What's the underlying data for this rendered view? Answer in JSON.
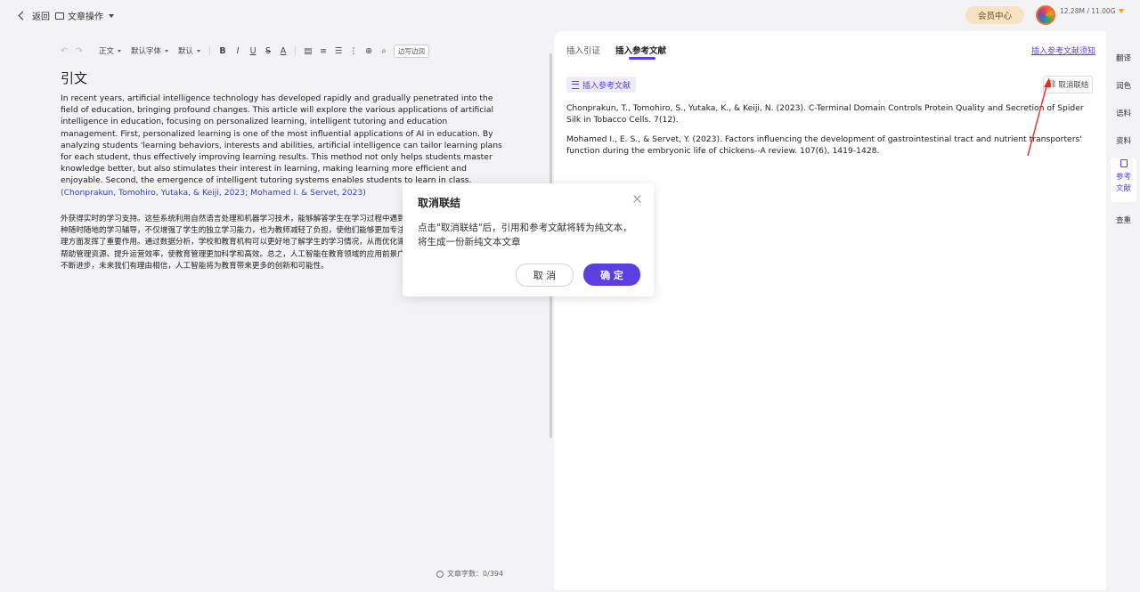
{
  "topbar": {
    "back_label": "返回",
    "doc_menu_label": "文章操作",
    "vip_label": "会员中心",
    "storage": "12.28M / 11.00G"
  },
  "toolbar": {
    "paragraph_style": "正文",
    "font_family": "默认字体",
    "font_size": "默认",
    "edit_mode_label": "边写边润"
  },
  "editor": {
    "title": "引文",
    "english_paragraph": "In recent years, artificial intelligence technology has developed rapidly and gradually penetrated into the field of education, bringing profound changes. This article will explore the various applications of artificial intelligence in education, focusing on personalized learning, intelligent tutoring and education management. First, personalized learning is one of the most influential applications of AI in education. By analyzing students 'learning behaviors, interests and abilities, artificial intelligence can tailor learning plans for each student, thus effectively improving learning results. This method not only helps students master knowledge better, but also stimulates their interest in learning, making learning more efficient and enjoyable. Second, the emergence of intelligent tutoring systems enables students to learn in class.",
    "english_citation": "(Chonprakun, Tomohiro, Yutaka, & Keiji, 2023; Mohamed I. & Servet, 2023)",
    "chinese_paragraph": "外获得实时的学习支持。这些系统利用自然语言处理和机器学习技术，能够解答学生在学习过程中遇到的问题，并提供个性化的反馈和建议。这种随时随地的学习辅导，不仅增强了学生的独立学习能力，也为教师减轻了负担，使他们能够更加专注于教学本身。此外，人工智能还在教育管理方面发挥了重要作用。通过数据分析，学校和教育机构可以更好地了解学生的学习情况，从而优化课程设置和教学策略。同时，人工智能可以帮助管理资源、提升运营效率，使教育管理更加科学和高效。总之，人工智能在教育领域的应用前景广阔，正在重新定义教学模式。随着技术的不断进步，未来我们有理由相信，人工智能将为教育带来更多的创新和可能性。",
    "word_count": "文章字数：0/394"
  },
  "panel": {
    "tabs": [
      {
        "label": "插入引证"
      },
      {
        "label": "插入参考文献"
      }
    ],
    "notice_link": "插入参考文献须知",
    "insert_button": "插入参考文献",
    "unlink_button": "取消联结",
    "references": [
      "Chonprakun, T., Tomohiro, S., Yutaka, K., & Keiji, N. (2023). C-Terminal Domain Controls Protein Quality and Secretion of Spider Silk in Tobacco Cells. 7(12).",
      "Mohamed I., E. S., & Servet, Y. (2023). Factors influencing the development of gastrointestinal tract and nutrient transporters' function during the embryonic life of chickens--A review. 107(6), 1419-1428."
    ]
  },
  "sidebar": {
    "items": [
      {
        "label": "翻译"
      },
      {
        "label": "润色"
      },
      {
        "label": "语料"
      },
      {
        "label": "资料"
      },
      {
        "label": "参考文献"
      },
      {
        "label": "查重"
      }
    ]
  },
  "dialog": {
    "title": "取消联结",
    "message": "点击\"取消联结\"后，引用和参考文献将转为纯文本，将生成一份新纯文本文章",
    "cancel_label": "取 消",
    "ok_label": "确 定"
  },
  "colors": {
    "accent": "#5b3fe0",
    "citation": "#3346c2",
    "annotation_arrow": "#e0301e"
  }
}
